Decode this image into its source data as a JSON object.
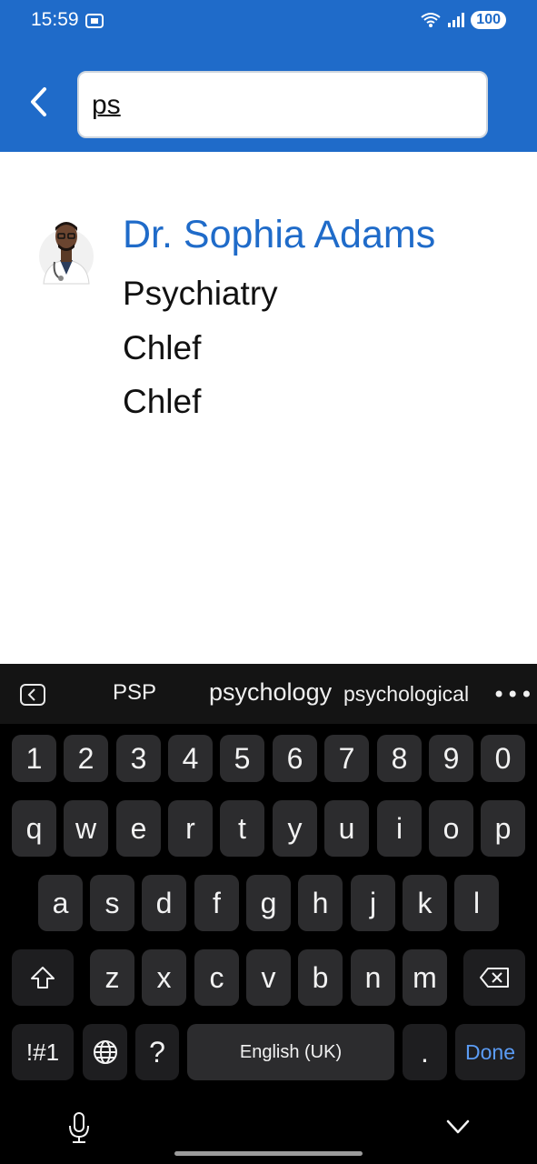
{
  "status_bar": {
    "time": "15:59",
    "battery": "100"
  },
  "search": {
    "value": "ps",
    "placeholder": ""
  },
  "result": {
    "name": "Dr. Sophia Adams",
    "specialty": "Psychiatry",
    "line2": "Chlef",
    "line3": "Chlef"
  },
  "keyboard": {
    "suggestions": [
      "PSP",
      "psychology",
      "psychological"
    ],
    "numbers": [
      "1",
      "2",
      "3",
      "4",
      "5",
      "6",
      "7",
      "8",
      "9",
      "0"
    ],
    "row1": [
      "q",
      "w",
      "e",
      "r",
      "t",
      "y",
      "u",
      "i",
      "o",
      "p"
    ],
    "row2": [
      "a",
      "s",
      "d",
      "f",
      "g",
      "h",
      "j",
      "k",
      "l"
    ],
    "row3": [
      "z",
      "x",
      "c",
      "v",
      "b",
      "n",
      "m"
    ],
    "symbols_label": "!#1",
    "question_label": "?",
    "space_label": "English (UK)",
    "period_label": ".",
    "done_label": "Done"
  },
  "colors": {
    "brand": "#1f6bc9",
    "done": "#5b9cf5"
  }
}
